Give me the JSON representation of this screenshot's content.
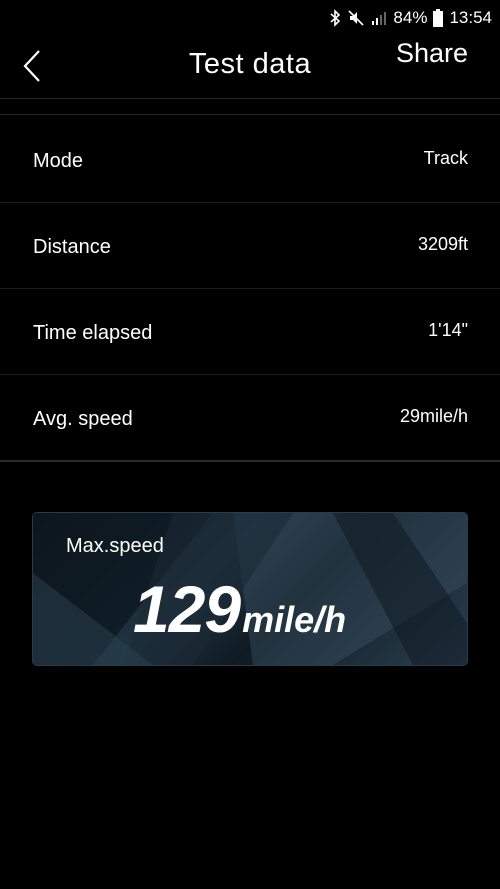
{
  "status_bar": {
    "battery": "84%",
    "time": "13:54",
    "icons": [
      "bluetooth-icon",
      "mute-icon",
      "signal-icon",
      "battery-icon"
    ]
  },
  "header": {
    "title": "Test data",
    "share_label": "Share"
  },
  "rows": [
    {
      "label": "Mode",
      "value": "Track"
    },
    {
      "label": "Distance",
      "value": "3209ft"
    },
    {
      "label": "Time elapsed",
      "value": "1'14\""
    },
    {
      "label": "Avg. speed",
      "value": "29mile/h"
    }
  ],
  "max_speed": {
    "caption": "Max.speed",
    "value": "129",
    "unit": "mile/h"
  }
}
